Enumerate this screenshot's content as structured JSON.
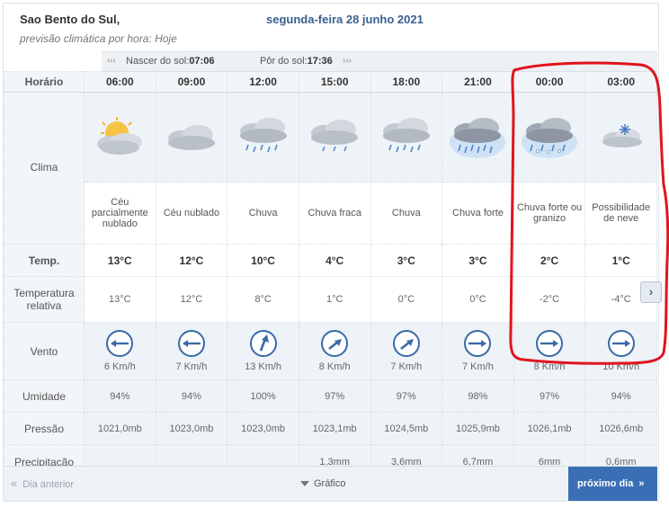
{
  "header": {
    "city": "Sao Bento do Sul,",
    "date": "segunda-feira 28 junho 2021",
    "subtitle": "previsão climática por hora: Hoje"
  },
  "sun": {
    "sunrise_label": "Nascer do sol:",
    "sunrise_time": "07:06",
    "sunset_label": "Pôr do sol:",
    "sunset_time": "17:36"
  },
  "row_labels": {
    "time": "Horário",
    "climate": "Clima",
    "temp": "Temp.",
    "relative": "Temperatura relativa",
    "wind": "Vento",
    "humidity": "Umidade",
    "pressure": "Pressão",
    "precip": "Precipitação"
  },
  "hours": [
    {
      "time": "06:00",
      "icon": "partly-cloudy-sun-icon",
      "desc": "Céu parcialmente nublado",
      "temp": "13°C",
      "rel": "13°C",
      "wind_dir": "west",
      "wind": "6 Km/h",
      "hum": "94%",
      "pres": "1021,0mb",
      "prec": ""
    },
    {
      "time": "09:00",
      "icon": "cloudy-icon",
      "desc": "Céu nublado",
      "temp": "12°C",
      "rel": "12°C",
      "wind_dir": "west",
      "wind": "7 Km/h",
      "hum": "94%",
      "pres": "1023,0mb",
      "prec": ""
    },
    {
      "time": "12:00",
      "icon": "rain-icon",
      "desc": "Chuva",
      "temp": "10°C",
      "rel": "8°C",
      "wind_dir": "north-northeast",
      "wind": "13 Km/h",
      "hum": "100%",
      "pres": "1023,0mb",
      "prec": ""
    },
    {
      "time": "15:00",
      "icon": "light-rain-icon",
      "desc": "Chuva fraca",
      "temp": "4°C",
      "rel": "1°C",
      "wind_dir": "northeast",
      "wind": "8 Km/h",
      "hum": "97%",
      "pres": "1023,1mb",
      "prec": "1,3mm"
    },
    {
      "time": "18:00",
      "icon": "rain-icon",
      "desc": "Chuva",
      "temp": "3°C",
      "rel": "0°C",
      "wind_dir": "northeast",
      "wind": "7 Km/h",
      "hum": "97%",
      "pres": "1024,5mb",
      "prec": "3,6mm"
    },
    {
      "time": "21:00",
      "icon": "heavy-rain-icon",
      "desc": "Chuva forte",
      "temp": "3°C",
      "rel": "0°C",
      "wind_dir": "east",
      "wind": "7 Km/h",
      "hum": "98%",
      "pres": "1025,9mb",
      "prec": "6,7mm"
    },
    {
      "time": "00:00",
      "icon": "heavy-rain-hail-icon",
      "desc": "Chuva forte ou granizo",
      "temp": "2°C",
      "rel": "-2°C",
      "wind_dir": "east",
      "wind": "8 Km/h",
      "hum": "97%",
      "pres": "1026,1mb",
      "prec": "6mm"
    },
    {
      "time": "03:00",
      "icon": "snow-icon",
      "desc": "Possibilidade de neve",
      "temp": "1°C",
      "rel": "-4°C",
      "wind_dir": "east",
      "wind": "10 Km/h",
      "hum": "94%",
      "pres": "1026,6mb",
      "prec": "0,6mm"
    }
  ],
  "footer": {
    "prev": "Dia anterior",
    "graph": "Gráfico",
    "next": "próximo dia"
  },
  "colors": {
    "accent": "#3a6fb5",
    "date_text": "#3a5f8f",
    "annotation": "#e0141e"
  }
}
